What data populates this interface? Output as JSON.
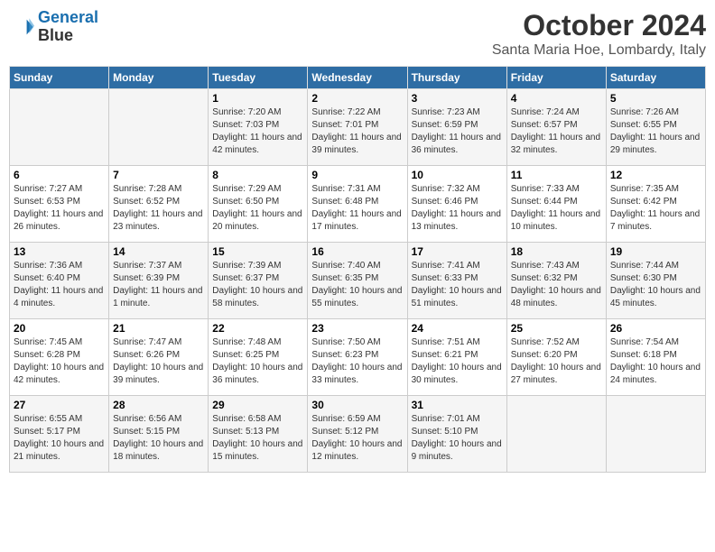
{
  "header": {
    "logo_line1": "General",
    "logo_line2": "Blue",
    "month": "October 2024",
    "location": "Santa Maria Hoe, Lombardy, Italy"
  },
  "weekdays": [
    "Sunday",
    "Monday",
    "Tuesday",
    "Wednesday",
    "Thursday",
    "Friday",
    "Saturday"
  ],
  "weeks": [
    [
      {
        "day": "",
        "info": ""
      },
      {
        "day": "",
        "info": ""
      },
      {
        "day": "1",
        "info": "Sunrise: 7:20 AM\nSunset: 7:03 PM\nDaylight: 11 hours and 42 minutes."
      },
      {
        "day": "2",
        "info": "Sunrise: 7:22 AM\nSunset: 7:01 PM\nDaylight: 11 hours and 39 minutes."
      },
      {
        "day": "3",
        "info": "Sunrise: 7:23 AM\nSunset: 6:59 PM\nDaylight: 11 hours and 36 minutes."
      },
      {
        "day": "4",
        "info": "Sunrise: 7:24 AM\nSunset: 6:57 PM\nDaylight: 11 hours and 32 minutes."
      },
      {
        "day": "5",
        "info": "Sunrise: 7:26 AM\nSunset: 6:55 PM\nDaylight: 11 hours and 29 minutes."
      }
    ],
    [
      {
        "day": "6",
        "info": "Sunrise: 7:27 AM\nSunset: 6:53 PM\nDaylight: 11 hours and 26 minutes."
      },
      {
        "day": "7",
        "info": "Sunrise: 7:28 AM\nSunset: 6:52 PM\nDaylight: 11 hours and 23 minutes."
      },
      {
        "day": "8",
        "info": "Sunrise: 7:29 AM\nSunset: 6:50 PM\nDaylight: 11 hours and 20 minutes."
      },
      {
        "day": "9",
        "info": "Sunrise: 7:31 AM\nSunset: 6:48 PM\nDaylight: 11 hours and 17 minutes."
      },
      {
        "day": "10",
        "info": "Sunrise: 7:32 AM\nSunset: 6:46 PM\nDaylight: 11 hours and 13 minutes."
      },
      {
        "day": "11",
        "info": "Sunrise: 7:33 AM\nSunset: 6:44 PM\nDaylight: 11 hours and 10 minutes."
      },
      {
        "day": "12",
        "info": "Sunrise: 7:35 AM\nSunset: 6:42 PM\nDaylight: 11 hours and 7 minutes."
      }
    ],
    [
      {
        "day": "13",
        "info": "Sunrise: 7:36 AM\nSunset: 6:40 PM\nDaylight: 11 hours and 4 minutes."
      },
      {
        "day": "14",
        "info": "Sunrise: 7:37 AM\nSunset: 6:39 PM\nDaylight: 11 hours and 1 minute."
      },
      {
        "day": "15",
        "info": "Sunrise: 7:39 AM\nSunset: 6:37 PM\nDaylight: 10 hours and 58 minutes."
      },
      {
        "day": "16",
        "info": "Sunrise: 7:40 AM\nSunset: 6:35 PM\nDaylight: 10 hours and 55 minutes."
      },
      {
        "day": "17",
        "info": "Sunrise: 7:41 AM\nSunset: 6:33 PM\nDaylight: 10 hours and 51 minutes."
      },
      {
        "day": "18",
        "info": "Sunrise: 7:43 AM\nSunset: 6:32 PM\nDaylight: 10 hours and 48 minutes."
      },
      {
        "day": "19",
        "info": "Sunrise: 7:44 AM\nSunset: 6:30 PM\nDaylight: 10 hours and 45 minutes."
      }
    ],
    [
      {
        "day": "20",
        "info": "Sunrise: 7:45 AM\nSunset: 6:28 PM\nDaylight: 10 hours and 42 minutes."
      },
      {
        "day": "21",
        "info": "Sunrise: 7:47 AM\nSunset: 6:26 PM\nDaylight: 10 hours and 39 minutes."
      },
      {
        "day": "22",
        "info": "Sunrise: 7:48 AM\nSunset: 6:25 PM\nDaylight: 10 hours and 36 minutes."
      },
      {
        "day": "23",
        "info": "Sunrise: 7:50 AM\nSunset: 6:23 PM\nDaylight: 10 hours and 33 minutes."
      },
      {
        "day": "24",
        "info": "Sunrise: 7:51 AM\nSunset: 6:21 PM\nDaylight: 10 hours and 30 minutes."
      },
      {
        "day": "25",
        "info": "Sunrise: 7:52 AM\nSunset: 6:20 PM\nDaylight: 10 hours and 27 minutes."
      },
      {
        "day": "26",
        "info": "Sunrise: 7:54 AM\nSunset: 6:18 PM\nDaylight: 10 hours and 24 minutes."
      }
    ],
    [
      {
        "day": "27",
        "info": "Sunrise: 6:55 AM\nSunset: 5:17 PM\nDaylight: 10 hours and 21 minutes."
      },
      {
        "day": "28",
        "info": "Sunrise: 6:56 AM\nSunset: 5:15 PM\nDaylight: 10 hours and 18 minutes."
      },
      {
        "day": "29",
        "info": "Sunrise: 6:58 AM\nSunset: 5:13 PM\nDaylight: 10 hours and 15 minutes."
      },
      {
        "day": "30",
        "info": "Sunrise: 6:59 AM\nSunset: 5:12 PM\nDaylight: 10 hours and 12 minutes."
      },
      {
        "day": "31",
        "info": "Sunrise: 7:01 AM\nSunset: 5:10 PM\nDaylight: 10 hours and 9 minutes."
      },
      {
        "day": "",
        "info": ""
      },
      {
        "day": "",
        "info": ""
      }
    ]
  ]
}
